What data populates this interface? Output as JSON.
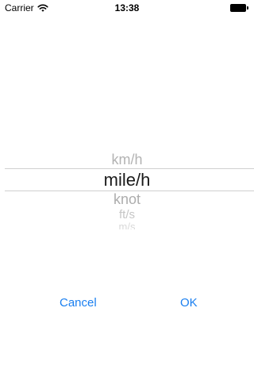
{
  "status_bar": {
    "carrier": "Carrier",
    "time": "13:38",
    "wifi_icon": "wifi-icon",
    "battery_icon": "battery-icon"
  },
  "picker": {
    "options": [
      "km/h",
      "mile/h",
      "knot",
      "ft/s",
      "m/s"
    ],
    "selected": "mile/h"
  },
  "actions": {
    "cancel_label": "Cancel",
    "ok_label": "OK"
  },
  "colors": {
    "accent": "#1a7ff0",
    "selected_text": "#1a1a1a",
    "faded_text": "#b3b3b3",
    "divider": "#d0d0d0"
  }
}
